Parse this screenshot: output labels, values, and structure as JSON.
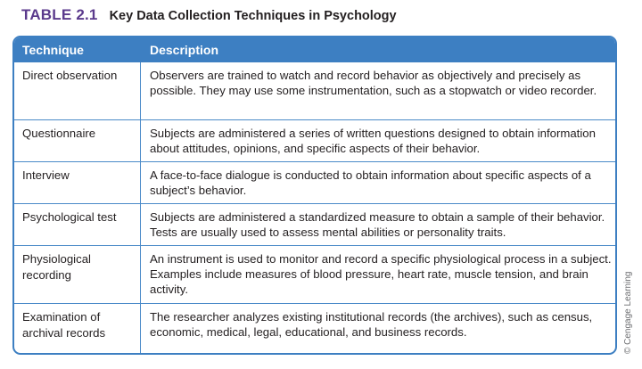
{
  "caption": {
    "number": "TABLE 2.1",
    "title": "Key Data Collection Techniques in Psychology"
  },
  "table": {
    "headers": [
      "Technique",
      "Description"
    ],
    "rows": [
      {
        "technique": "Direct observation",
        "description": "Observers are trained to watch and record behavior as objectively and precisely as possible. They may use some instrumentation, such as a stopwatch or video recorder."
      },
      {
        "technique": "Questionnaire",
        "description": "Subjects are administered a series of written questions designed to obtain information about attitudes, opinions, and specific aspects of their behavior."
      },
      {
        "technique": "Interview",
        "description": "A face-to-face dialogue is conducted to obtain information about specific aspects of a subject’s behavior."
      },
      {
        "technique": "Psychological test",
        "description": "Subjects are administered a standardized measure to obtain a sample of their behavior. Tests are usually used to assess mental abilities or personality traits."
      },
      {
        "technique": "Physiological recording",
        "description": "An instrument is used to monitor and record a specific physiological process in a subject. Examples include measures of blood pressure, heart rate, muscle tension, and brain activity."
      },
      {
        "technique": "Examination of archival records",
        "description": "The researcher analyzes existing institutional records (the archives), such as census, economic, medical, legal, educational, and business records."
      }
    ]
  },
  "credit": "© Cengage Learning",
  "colors": {
    "accent_blue": "#3d7fc2",
    "caption_purple": "#5b3a8c"
  }
}
